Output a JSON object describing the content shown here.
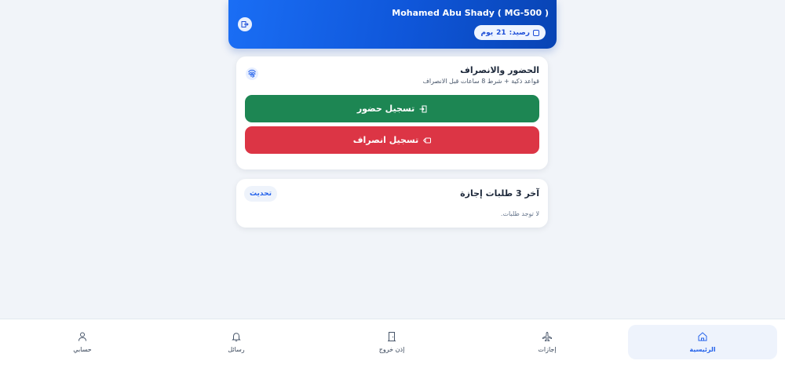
{
  "header": {
    "user_name": "Mohamed Abu Shady ( MG-500 )",
    "balance_label": "رصيد:",
    "balance_value": "21",
    "balance_unit": "يوم"
  },
  "attendance": {
    "title": "الحضور والانصراف",
    "subtitle": "قواعد ذكية + شرط 8 ساعات قبل الانصراف",
    "check_in_label": "تسجيل حضور",
    "check_out_label": "تسجيل انصراف"
  },
  "requests": {
    "title": "آخر 3 طلبات إجازة",
    "refresh_label": "تحديث",
    "empty_text": "لا توجد طلبات."
  },
  "nav": {
    "items": [
      {
        "label": "الرئيسية",
        "icon": "home-icon",
        "active": true
      },
      {
        "label": "إجازات",
        "icon": "plane-icon"
      },
      {
        "label": "إذن خروج",
        "icon": "door-icon"
      },
      {
        "label": "رسائل",
        "icon": "bell-icon"
      },
      {
        "label": "حسابي",
        "icon": "user-icon"
      }
    ]
  },
  "colors": {
    "primary": "#1a6ef5",
    "check_in": "#1d8653",
    "check_out": "#dc3545",
    "background": "#f1f4f9"
  }
}
